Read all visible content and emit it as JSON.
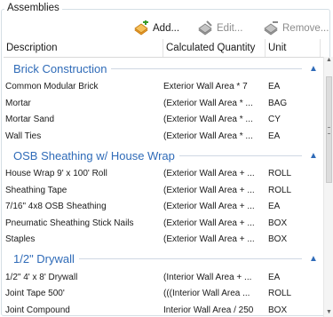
{
  "groupbox": {
    "title": "Assemblies"
  },
  "toolbar": {
    "add_label": "Add...",
    "edit_label": "Edit...",
    "remove_label": "Remove..."
  },
  "columns": {
    "description": "Description",
    "quantity": "Calculated Quantity",
    "unit": "Unit"
  },
  "groups": [
    {
      "title": "Brick Construction",
      "rows": [
        {
          "description": "Common Modular Brick",
          "quantity": "Exterior Wall Area * 7",
          "unit": "EA"
        },
        {
          "description": "Mortar",
          "quantity": "(Exterior Wall Area * ...",
          "unit": "BAG"
        },
        {
          "description": "Mortar Sand",
          "quantity": "(Exterior Wall Area * ...",
          "unit": "CY"
        },
        {
          "description": "Wall Ties",
          "quantity": "(Exterior Wall Area * ...",
          "unit": "EA"
        }
      ]
    },
    {
      "title": "OSB Sheathing w/ House Wrap",
      "rows": [
        {
          "description": "House Wrap 9' x 100' Roll",
          "quantity": "(Exterior Wall Area + ...",
          "unit": "ROLL"
        },
        {
          "description": "Sheathing Tape",
          "quantity": "(Exterior Wall Area + ...",
          "unit": "ROLL"
        },
        {
          "description": "7/16\" 4x8 OSB Sheathing",
          "quantity": "(Exterior Wall Area + ...",
          "unit": "EA"
        },
        {
          "description": "Pneumatic Sheathing Stick Nails",
          "quantity": "(Exterior Wall Area + ...",
          "unit": "BOX"
        },
        {
          "description": "Staples",
          "quantity": "(Exterior Wall Area + ...",
          "unit": "BOX"
        }
      ]
    },
    {
      "title": "1/2\" Drywall",
      "rows": [
        {
          "description": "1/2\" 4' x 8' Drywall",
          "quantity": "(Interior Wall Area + ...",
          "unit": "EA"
        },
        {
          "description": "Joint Tape 500'",
          "quantity": "(((Interior Wall Area ...",
          "unit": "ROLL"
        },
        {
          "description": "Joint Compound",
          "quantity": "Interior Wall Area / 250",
          "unit": "BOX"
        }
      ]
    }
  ]
}
